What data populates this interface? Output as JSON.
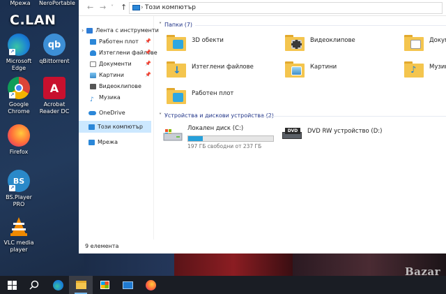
{
  "desktop": {
    "overlay_text": "C.LAN",
    "icons": [
      {
        "label": "Мрежа",
        "icon": "network-icon"
      },
      {
        "label": "NeroPortable",
        "icon": "nero-icon"
      },
      {
        "label": "Microsoft Edge",
        "icon": "edge-icon"
      },
      {
        "label": "qBittorrent",
        "icon": "qbittorrent-icon"
      },
      {
        "label": "Google Chrome",
        "icon": "chrome-icon"
      },
      {
        "label": "Acrobat Reader DC",
        "icon": "acrobat-icon"
      },
      {
        "label": "Firefox",
        "icon": "firefox-icon"
      },
      {
        "label": "BS.Player PRO",
        "icon": "bsplayer-icon"
      },
      {
        "label": "VLC media player",
        "icon": "vlc-icon"
      }
    ],
    "watermark": "Bazar"
  },
  "explorer": {
    "address": {
      "path": "Този компютър"
    },
    "nav": {
      "quick_access": "Лента с инструменти",
      "items": [
        {
          "label": "Работен плот",
          "icon": "desktop-icon",
          "pinned": true
        },
        {
          "label": "Изтеглени файлове",
          "icon": "downloads-icon",
          "pinned": true
        },
        {
          "label": "Документи",
          "icon": "documents-icon",
          "pinned": true
        },
        {
          "label": "Картини",
          "icon": "pictures-icon",
          "pinned": true
        },
        {
          "label": "Видеоклипове",
          "icon": "videos-icon",
          "pinned": false
        },
        {
          "label": "Музика",
          "icon": "music-icon",
          "pinned": false
        }
      ],
      "onedrive": "OneDrive",
      "this_pc": "Този компютър",
      "network": "Мрежа"
    },
    "folders_group": {
      "title": "Папки (7)",
      "items": [
        {
          "name": "3D обекти",
          "icon": "3d-objects-icon"
        },
        {
          "name": "Видеоклипове",
          "icon": "videos-folder-icon"
        },
        {
          "name": "Документи",
          "icon": "documents-folder-icon"
        },
        {
          "name": "Изтеглени файлове",
          "icon": "downloads-folder-icon"
        },
        {
          "name": "Картини",
          "icon": "pictures-folder-icon"
        },
        {
          "name": "Музика",
          "icon": "music-folder-icon"
        },
        {
          "name": "Работен плот",
          "icon": "desktop-folder-icon"
        }
      ]
    },
    "drives_group": {
      "title": "Устройства и дискови устройства (2)",
      "local_disk": {
        "name": "Локален диск (C:)",
        "free": "197 ГБ свободни от 237 ГБ",
        "used_fraction": 0.17
      },
      "dvd": {
        "name": "DVD RW устройство (D:)",
        "badge": "DVD"
      }
    },
    "status": "9 елемента"
  },
  "taskbar": {
    "items": [
      "start-icon",
      "search-icon",
      "edge-icon",
      "file-explorer-icon",
      "store-icon",
      "mail-icon",
      "firefox-icon"
    ]
  },
  "colors": {
    "accent": "#26a0da",
    "selection": "#cce8ff",
    "folder": "#f4c54e"
  }
}
